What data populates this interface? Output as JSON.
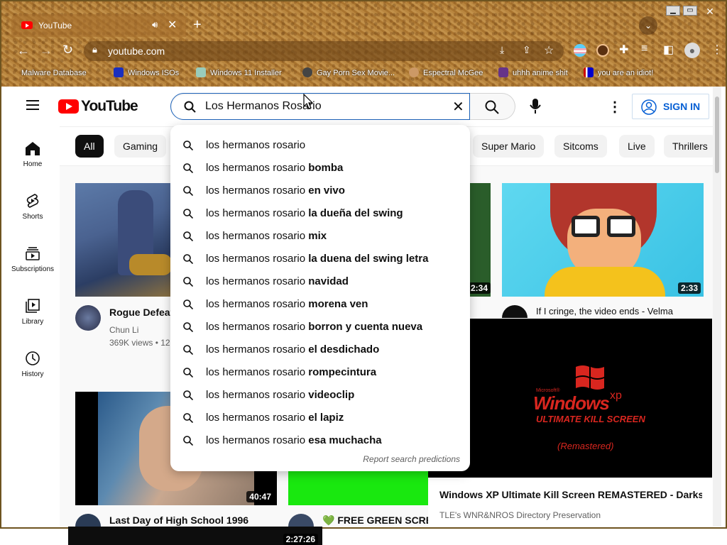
{
  "browser": {
    "tab_title": "YouTube",
    "url": "youtube.com",
    "bookmarks": [
      "Malware Database",
      "Windows ISOs",
      "Windows 11 Installer",
      "Gay Porn Sex Movie...",
      "Espectral McGee",
      "uhhh anime shit",
      "you are an idiot!"
    ]
  },
  "youtube": {
    "logo_text": "YouTube",
    "search_value": "Los Hermanos Rosario",
    "sign_in": "SIGN IN",
    "sidebar": [
      {
        "label": "Home",
        "icon": "home-icon"
      },
      {
        "label": "Shorts",
        "icon": "shorts-icon"
      },
      {
        "label": "Subscriptions",
        "icon": "subscriptions-icon"
      },
      {
        "label": "Library",
        "icon": "library-icon"
      },
      {
        "label": "History",
        "icon": "history-icon"
      }
    ],
    "chips": [
      "All",
      "Gaming",
      "Super Mario",
      "Sitcoms",
      "Live",
      "Thrillers"
    ],
    "suggestions": [
      {
        "base": "los hermanos rosario",
        "rest": ""
      },
      {
        "base": "los hermanos rosario ",
        "rest": "bomba"
      },
      {
        "base": "los hermanos rosario ",
        "rest": "en vivo"
      },
      {
        "base": "los hermanos rosario ",
        "rest": "la dueña del swing"
      },
      {
        "base": "los hermanos rosario ",
        "rest": "mix"
      },
      {
        "base": "los hermanos rosario ",
        "rest": "la duena del swing letra"
      },
      {
        "base": "los hermanos rosario ",
        "rest": "navidad"
      },
      {
        "base": "los hermanos rosario ",
        "rest": "morena ven"
      },
      {
        "base": "los hermanos rosario ",
        "rest": "borron y cuenta nueva"
      },
      {
        "base": "los hermanos rosario ",
        "rest": "el desdichado"
      },
      {
        "base": "los hermanos rosario ",
        "rest": "rompecintura"
      },
      {
        "base": "los hermanos rosario ",
        "rest": "videoclip"
      },
      {
        "base": "los hermanos rosario ",
        "rest": "el lapiz"
      },
      {
        "base": "los hermanos rosario ",
        "rest": "esa muchacha"
      }
    ],
    "report_text": "Report search predictions",
    "videos": {
      "v1": {
        "title": "Rogue Defeat",
        "channel": "Chun Li",
        "meta": "369K views • 12"
      },
      "v2": {
        "duration": "2:34"
      },
      "v3": {
        "title": "If I cringe, the video ends - Velma",
        "duration": "2:33"
      },
      "v4": {
        "title": "Last Day of High School 1996",
        "duration": "40:47"
      },
      "v5": {
        "title": "FREE GREEN SCREEN",
        "heart": "💚"
      },
      "v6": {
        "title": "Windows XP Ultimate Kill Screen REMASTERED - Darkso...",
        "channel": "TLE's WNR&NROS Directory Preservation",
        "logo_small": "Microsoft®",
        "logo_main": "Windows",
        "logo_xp": "xp",
        "logo_sub": "ULTIMATE KILL SCREEN",
        "logo_remaster": "(Remastered)"
      },
      "v7": {
        "duration": "2:27:26"
      }
    }
  }
}
